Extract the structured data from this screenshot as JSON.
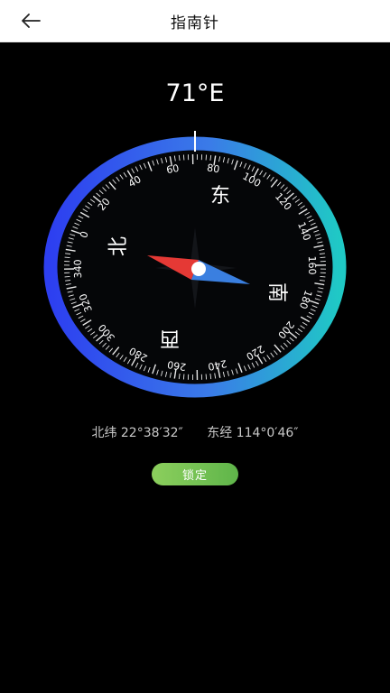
{
  "header": {
    "title": "指南针",
    "back_icon": "arrow-left-icon"
  },
  "compass": {
    "heading_text": "71°E",
    "heading_degrees": 71,
    "cardinals": {
      "north": "北",
      "east": "东",
      "south": "南",
      "west": "西"
    },
    "tick_labels": [
      0,
      20,
      40,
      60,
      80,
      100,
      120,
      140,
      160,
      180,
      200,
      220,
      240,
      260,
      280,
      300,
      320,
      340
    ],
    "colors": {
      "ring_start": "#2d3ff0",
      "ring_mid": "#3a7be8",
      "ring_end": "#1fc9c5",
      "needle_north": "#e53935",
      "needle_south": "#3a7fe0"
    }
  },
  "location": {
    "latitude": "北纬 22°38′32″",
    "longitude": "东经 114°0′46″"
  },
  "actions": {
    "lock_label": "锁定",
    "lock_color": "#6cc04f"
  }
}
